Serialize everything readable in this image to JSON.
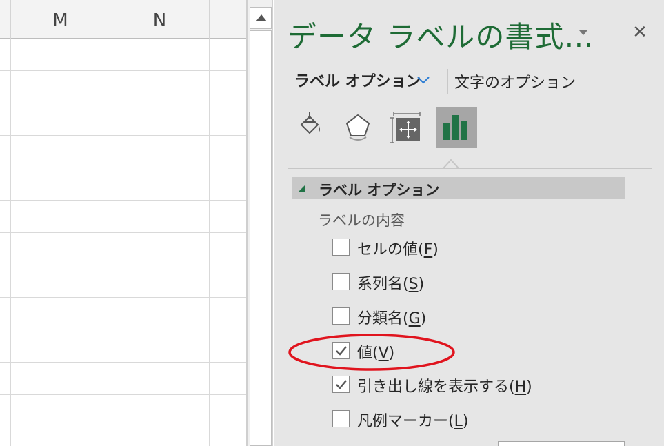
{
  "sheet": {
    "columns": [
      "M",
      "N"
    ]
  },
  "pane": {
    "title": "データ ラベルの書式…",
    "close_glyph": "✕",
    "tabs": {
      "label_options": "ラベル オプション",
      "text_options": "文字のオプション"
    },
    "icons": [
      "fill-line-icon",
      "effects-icon",
      "size-properties-icon",
      "label-options-icon"
    ],
    "section": {
      "label": "ラベル オプション",
      "expanded": true
    },
    "subheading": "ラベルの内容",
    "options": [
      {
        "pre": "セルの値(",
        "key": "F",
        "post": ")",
        "checked": false
      },
      {
        "pre": "系列名(",
        "key": "S",
        "post": ")",
        "checked": false
      },
      {
        "pre": "分類名(",
        "key": "G",
        "post": ")",
        "checked": false
      },
      {
        "pre": "値(",
        "key": "V",
        "post": ")",
        "checked": true
      },
      {
        "pre": "引き出し線を表示する(",
        "key": "H",
        "post": ")",
        "checked": true
      },
      {
        "pre": "凡例マーカー(",
        "key": "L",
        "post": ")",
        "checked": false
      }
    ],
    "colors": {
      "accent_green": "#1e6b35",
      "chart_icon_green": "#217346",
      "highlight_red": "#e0141e",
      "chevron_blue": "#2b7cd3"
    }
  }
}
